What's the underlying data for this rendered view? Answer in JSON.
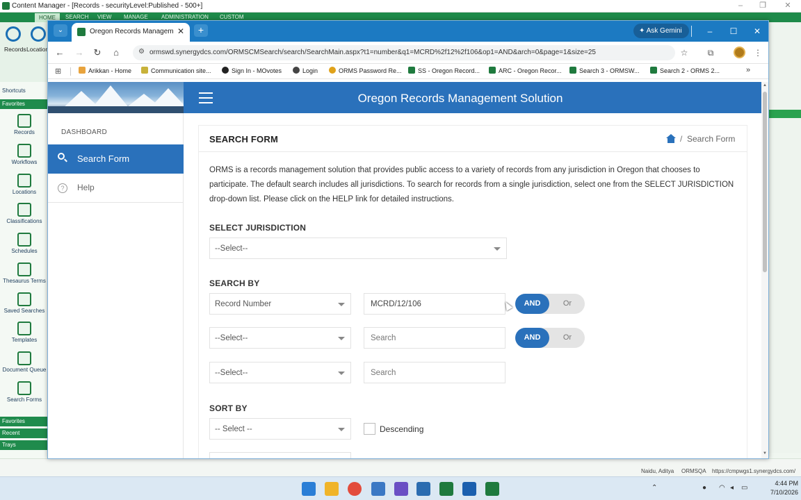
{
  "cm": {
    "window_title": "Content Manager - [Records - securityLevel:Published - 500+]",
    "ribbon_tabs": [
      "HOME",
      "SEARCH",
      "VIEW",
      "MANAGE",
      "ADMINISTRATION",
      "CUSTOM"
    ],
    "ribbon_buttons": [
      "Records",
      "Location"
    ],
    "sections": [
      "Shortcuts",
      "Favorites"
    ],
    "nav": [
      "Records",
      "Workflows",
      "Locations",
      "Classifications",
      "Schedules",
      "Thesaurus Terms",
      "Saved Searches",
      "Templates",
      "Document Queue",
      "Search Forms"
    ],
    "bottom_sections": [
      "Favorites",
      "Recent",
      "Trays"
    ],
    "status_user": "Naidu, Aditya",
    "status_db": "ORMSQA",
    "status_url": "https://cmpwgs1.synergydcs.com/"
  },
  "browser": {
    "tab_title": "Oregon Records Management",
    "ask_gemini": "Ask Gemini",
    "url": "ormswd.synergydcs.com/ORMSCMSearch/search/SearchMain.aspx?t1=number&q1=MCRD%2f12%2f106&op1=AND&arch=0&page=1&size=25",
    "bookmarks": [
      {
        "label": "Arikkan - Home",
        "color": "#e8a33d"
      },
      {
        "label": "Communication site...",
        "color": "#c8b23a"
      },
      {
        "label": "Sign In - MOvotes",
        "color": "#222222"
      },
      {
        "label": "Login",
        "color": "#444444"
      },
      {
        "label": "ORMS Password Re...",
        "color": "#e0a21a"
      },
      {
        "label": "SS - Oregon Record...",
        "color": "#1f7a3e"
      },
      {
        "label": "ARC - Oregon Recor...",
        "color": "#1f7a3e"
      },
      {
        "label": "Search 3 - ORMSW...",
        "color": "#1f7a3e"
      },
      {
        "label": "Search 2 - ORMS 2...",
        "color": "#1f7a3e"
      }
    ]
  },
  "app": {
    "title": "Oregon Records Management Solution",
    "sidenav": {
      "dashboard": "DASHBOARD",
      "search_form": "Search Form",
      "help": "Help"
    }
  },
  "form": {
    "card_title": "SEARCH FORM",
    "breadcrumb_sep": "/",
    "breadcrumb_current": "Search Form",
    "intro": "ORMS is a records management solution that provides public access to a variety of records from any jurisdiction in Oregon that chooses to participate. The default search includes all jurisdictions. To search for records from a single jurisdiction, select one from the SELECT JURISDICTION drop-down list. Please click on the HELP link for detailed instructions.",
    "jurisdiction_label": "SELECT JURISDICTION",
    "jurisdiction_value": "--Select--",
    "search_by_label": "SEARCH BY",
    "rows": [
      {
        "field": "Record Number",
        "value": "MCRD/12/106",
        "placeholder": "",
        "and": "AND",
        "or": "Or"
      },
      {
        "field": "--Select--",
        "value": "",
        "placeholder": "Search",
        "and": "AND",
        "or": "Or"
      },
      {
        "field": "--Select--",
        "value": "",
        "placeholder": "Search"
      }
    ],
    "sort_by_label": "SORT BY",
    "sort_value": "-- Select --",
    "descending_label": "Descending"
  },
  "taskbar": {
    "time": "4:44 PM",
    "date": "7/10/2026"
  },
  "colors": {
    "primary": "#2a71bb",
    "cm_green": "#1f8b4c"
  }
}
